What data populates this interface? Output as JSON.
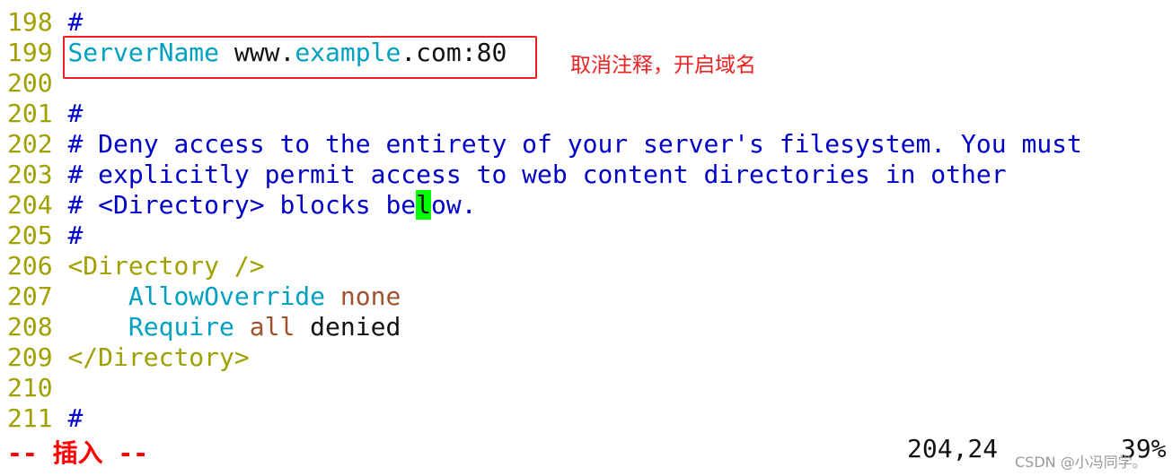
{
  "lines": [
    {
      "n": "198",
      "segs": [
        {
          "t": "#",
          "c": "comment"
        }
      ]
    },
    {
      "n": "199",
      "segs": [
        {
          "t": "ServerName",
          "c": "cyan"
        },
        {
          "t": " www.",
          "c": "normal"
        },
        {
          "t": "example",
          "c": "cyan"
        },
        {
          "t": ".com:80",
          "c": "normal"
        }
      ]
    },
    {
      "n": "200",
      "segs": []
    },
    {
      "n": "201",
      "segs": [
        {
          "t": "#",
          "c": "comment"
        }
      ]
    },
    {
      "n": "202",
      "segs": [
        {
          "t": "# Deny access to the entirety of your server's filesystem. You must",
          "c": "comment"
        }
      ]
    },
    {
      "n": "203",
      "segs": [
        {
          "t": "# explicitly permit access to web content directories in other",
          "c": "comment"
        }
      ]
    },
    {
      "n": "204",
      "segs": [
        {
          "t": "# <Directory> blocks be",
          "c": "comment"
        },
        {
          "t": "l",
          "c": "cursor"
        },
        {
          "t": "ow.",
          "c": "comment"
        }
      ]
    },
    {
      "n": "205",
      "segs": [
        {
          "t": "#",
          "c": "comment"
        }
      ]
    },
    {
      "n": "206",
      "segs": [
        {
          "t": "<Directory />",
          "c": "olive"
        }
      ]
    },
    {
      "n": "207",
      "segs": [
        {
          "t": "    AllowOverride",
          "c": "cyan"
        },
        {
          "t": " none",
          "c": "brown"
        }
      ]
    },
    {
      "n": "208",
      "segs": [
        {
          "t": "    Require",
          "c": "cyan"
        },
        {
          "t": " all",
          "c": "brown"
        },
        {
          "t": " denied",
          "c": "normal"
        }
      ]
    },
    {
      "n": "209",
      "segs": [
        {
          "t": "</Directory>",
          "c": "olive"
        }
      ]
    },
    {
      "n": "210",
      "segs": []
    },
    {
      "n": "211",
      "segs": [
        {
          "t": "#",
          "c": "comment"
        }
      ]
    }
  ],
  "annotation": "取消注释，开启域名",
  "status": {
    "mode": "-- 插入 --",
    "position": "204,24",
    "percent": "39%"
  },
  "watermark": "CSDN @小冯同学。",
  "colors": {
    "line_number": "#a0a000",
    "comment": "#0000c8",
    "keyword": "#00a0c0",
    "value": "#a0522d",
    "annotation": "#f02020",
    "cursor": "#00ff00"
  }
}
